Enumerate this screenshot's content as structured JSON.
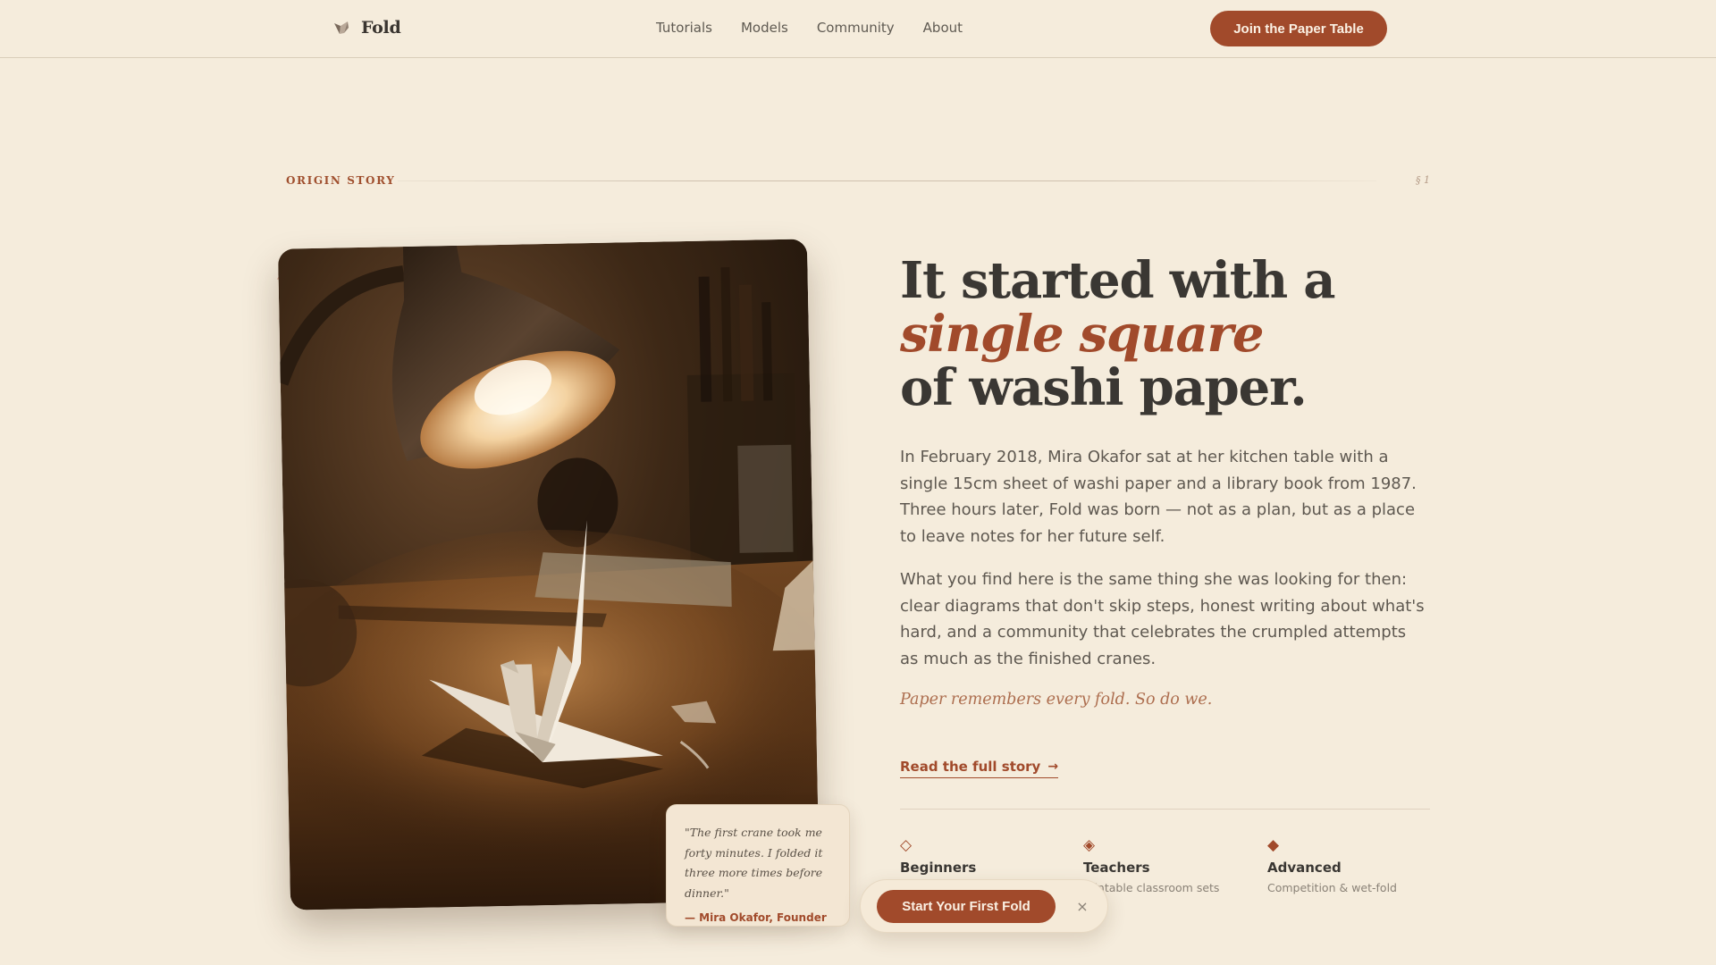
{
  "header": {
    "brand_name": "Fold",
    "nav": [
      "Tutorials",
      "Models",
      "Community",
      "About"
    ],
    "cta": "Join the Paper Table"
  },
  "section": {
    "label": "ORIGIN STORY",
    "number": "§ 1"
  },
  "headline": {
    "line1": "It started with a",
    "accent": "single square",
    "line3": "of washi paper."
  },
  "body": {
    "para1": "In February 2018, Mira Okafor sat at her kitchen table with a single 15cm sheet of washi paper and a library book from 1987. Three hours later, Fold was born — not as a plan, but as a place to leave notes for her future self.",
    "para2": "What you find here is the same thing she was looking for then: clear diagrams that don't skip steps, honest writing about what's hard, and a community that celebrates the crumpled attempts as much as the finished cranes.",
    "tagline": "Paper remembers every fold. So do we.",
    "read_link": "Read the full story",
    "read_arrow": "→"
  },
  "quote": {
    "text": "\"The first crane took me forty minutes. I folded it three more times before dinner.\"",
    "author": "— Mira Okafor, Founder"
  },
  "levels": [
    {
      "glyph": "◇",
      "title": "Beginners",
      "desc": ""
    },
    {
      "glyph": "◈",
      "title": "Teachers",
      "desc": "Printable classroom sets"
    },
    {
      "glyph": "◆",
      "title": "Advanced",
      "desc": "Competition & wet-fold"
    }
  ],
  "floating": {
    "cta": "Start Your First Fold",
    "close": "×"
  },
  "colors": {
    "background": "#f5ecdc",
    "accent": "#a14a2b",
    "text": "#3a3733"
  }
}
